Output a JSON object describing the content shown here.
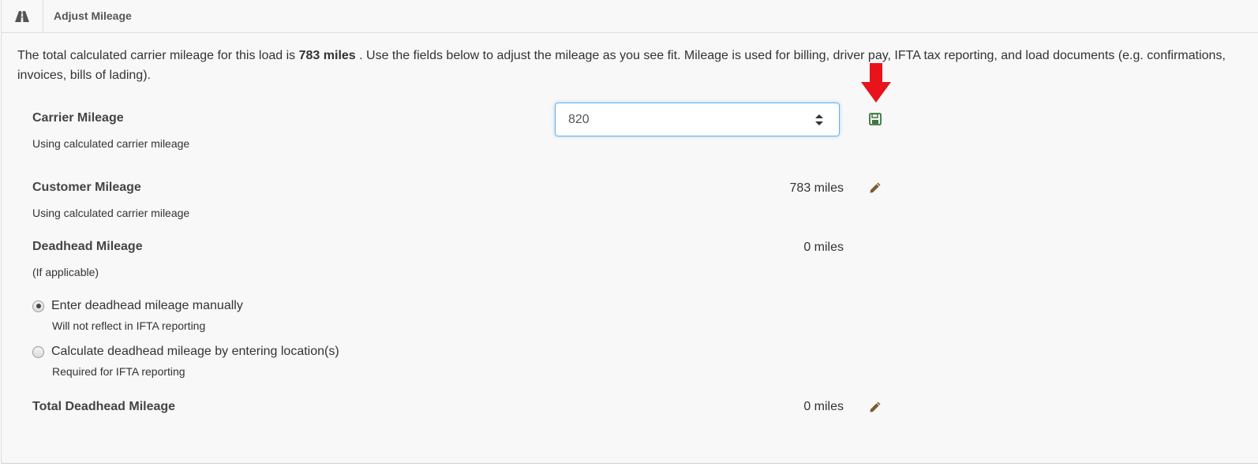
{
  "header": {
    "title": "Adjust Mileage",
    "icon": "road-icon"
  },
  "intro": {
    "prefix": "The total calculated carrier mileage for this load is",
    "total": "783 miles",
    "suffix": ". Use the fields below to adjust the mileage as you see fit. Mileage is used for billing, driver pay, IFTA tax reporting, and load documents (e.g. confirmations, invoices, bills of lading)."
  },
  "carrier": {
    "label": "Carrier Mileage",
    "note": "Using calculated carrier mileage",
    "input_value": "820",
    "save_icon": "save-icon"
  },
  "customer": {
    "label": "Customer Mileage",
    "note": "Using calculated carrier mileage",
    "value": "783 miles",
    "edit_icon": "pencil-icon"
  },
  "deadhead": {
    "label": "Deadhead Mileage",
    "note": "(If applicable)",
    "value": "0 miles",
    "options": [
      {
        "label": "Enter deadhead mileage manually",
        "hint": "Will not reflect in IFTA reporting",
        "checked": true
      },
      {
        "label": "Calculate deadhead mileage by entering location(s)",
        "hint": "Required for IFTA reporting",
        "checked": false
      }
    ]
  },
  "total_deadhead": {
    "label": "Total Deadhead Mileage",
    "value": "0 miles",
    "edit_icon": "pencil-icon"
  },
  "colors": {
    "annotation_arrow": "#e8141c",
    "save_icon": "#3c763d",
    "pencil_icon": "#7a5c2e",
    "input_focus_border": "#66afe9"
  }
}
